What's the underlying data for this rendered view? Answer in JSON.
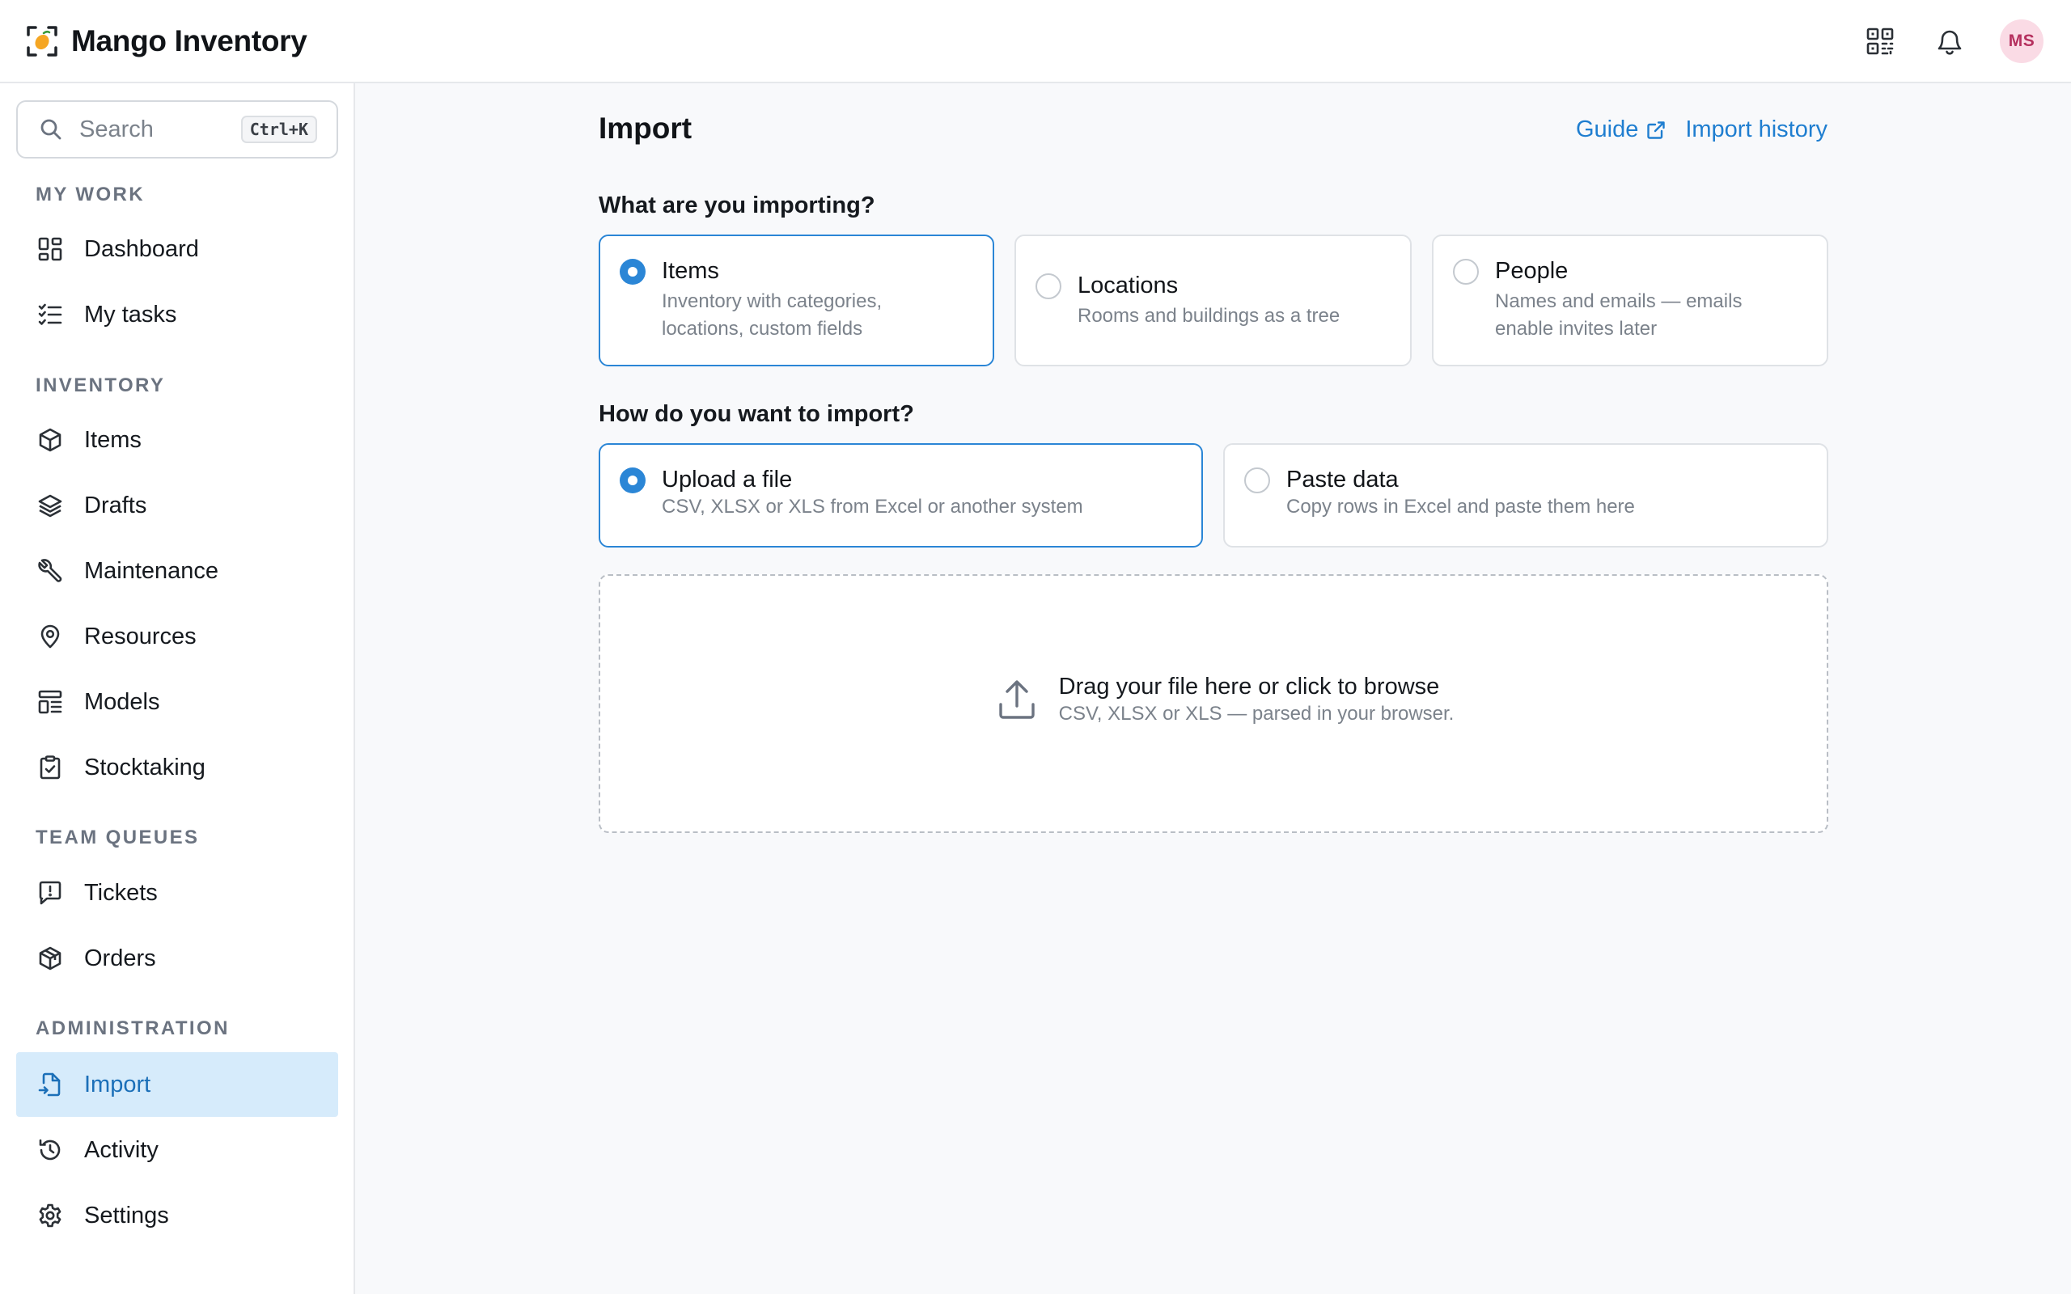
{
  "app": {
    "title": "Mango Inventory"
  },
  "header": {
    "avatar_initials": "MS",
    "icons": [
      "qr-code-icon",
      "bell-icon"
    ]
  },
  "sidebar": {
    "search": {
      "placeholder": "Search",
      "shortcut": "Ctrl+K"
    },
    "sections": [
      {
        "label": "MY WORK",
        "items": [
          {
            "label": "Dashboard",
            "icon": "dashboard-icon"
          },
          {
            "label": "My tasks",
            "icon": "tasks-icon"
          }
        ]
      },
      {
        "label": "INVENTORY",
        "items": [
          {
            "label": "Items",
            "icon": "cube-icon"
          },
          {
            "label": "Drafts",
            "icon": "layers-icon"
          },
          {
            "label": "Maintenance",
            "icon": "wrench-icon"
          },
          {
            "label": "Resources",
            "icon": "map-pin-icon"
          },
          {
            "label": "Models",
            "icon": "template-icon"
          },
          {
            "label": "Stocktaking",
            "icon": "clipboard-check-icon"
          }
        ]
      },
      {
        "label": "TEAM QUEUES",
        "items": [
          {
            "label": "Tickets",
            "icon": "message-alert-icon"
          },
          {
            "label": "Orders",
            "icon": "package-icon"
          }
        ]
      },
      {
        "label": "ADMINISTRATION",
        "items": [
          {
            "label": "Import",
            "icon": "file-import-icon",
            "active": true
          },
          {
            "label": "Activity",
            "icon": "history-icon"
          },
          {
            "label": "Settings",
            "icon": "gear-icon"
          }
        ]
      }
    ]
  },
  "main": {
    "title": "Import",
    "links": {
      "guide": "Guide",
      "history": "Import history"
    },
    "type_question": "What are you importing?",
    "types": [
      {
        "title": "Items",
        "desc_lines": [
          "Inventory with categories,",
          "locations, custom fields"
        ],
        "selected": true
      },
      {
        "title": "Locations",
        "desc_lines": [
          "Rooms and buildings as a tree"
        ],
        "selected": false
      },
      {
        "title": "People",
        "desc_lines": [
          "Names and emails — emails",
          "enable invites later"
        ],
        "selected": false
      }
    ],
    "method_question": "How do you want to import?",
    "methods": [
      {
        "title": "Upload a file",
        "desc": "CSV, XLSX or XLS from Excel or another system",
        "selected": true
      },
      {
        "title": "Paste data",
        "desc": "Copy rows in Excel and paste them here",
        "selected": false
      }
    ],
    "dropzone": {
      "title": "Drag your file here or click to browse",
      "subtitle": "CSV, XLSX or XLS — parsed in your browser."
    }
  },
  "colors": {
    "accent": "#2b86d6",
    "link": "#1f7ed0",
    "active_bg": "#d6ebfb",
    "brand_orange": "#f5a623"
  }
}
